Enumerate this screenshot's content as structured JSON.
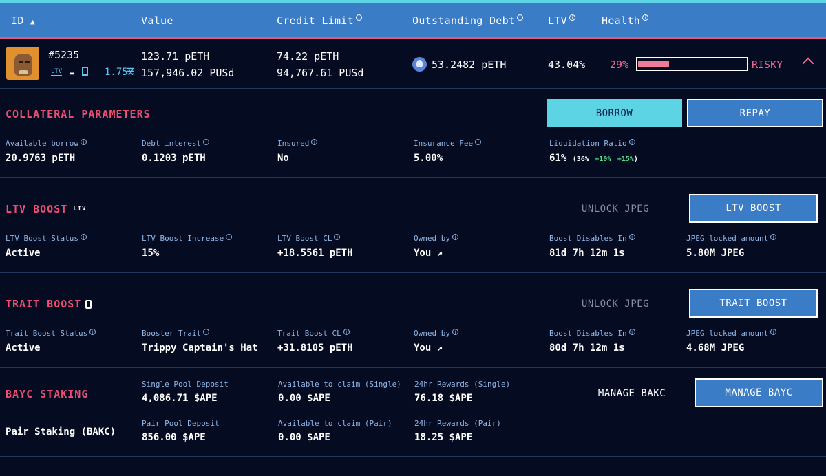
{
  "header": {
    "id": "ID",
    "value": "Value",
    "credit_limit": "Credit Limit",
    "outstanding_debt": "Outstanding Debt",
    "ltv": "LTV",
    "health": "Health"
  },
  "position": {
    "id": "#5235",
    "boost_icons": "LTV",
    "multiplier": "1.75x",
    "value_peth": "123.71 pETH",
    "value_pusd": "157,946.02 PUSd",
    "credit_peth": "74.22 pETH",
    "credit_pusd": "94,767.61 PUSd",
    "debt": "53.2482 pETH",
    "ltv": "43.04%",
    "health_pct": "29%",
    "health_fill": 0.29,
    "health_status": "RISKY"
  },
  "collateral": {
    "title": "COLLATERAL PARAMETERS",
    "borrow_label": "BORROW",
    "repay_label": "REPAY",
    "fields": [
      {
        "label": "Available borrow",
        "value": "20.9763 pETH"
      },
      {
        "label": "Debt interest",
        "value": "0.1203 pETH"
      },
      {
        "label": "Insured",
        "value": "No"
      },
      {
        "label": "Insurance Fee",
        "value": "5.00%"
      },
      {
        "label": "Liquidation Ratio",
        "value": "61%",
        "detail_a": "(36%",
        "detail_b": "+10%",
        "detail_c": "+15%",
        "detail_d": ")"
      }
    ]
  },
  "ltv_boost": {
    "title": "LTV BOOST",
    "unlock_label": "UNLOCK JPEG",
    "button_label": "LTV BOOST",
    "fields": [
      {
        "label": "LTV Boost Status",
        "value": "Active"
      },
      {
        "label": "LTV Boost Increase",
        "value": "15%"
      },
      {
        "label": "LTV Boost CL",
        "value": "+18.5561 pETH"
      },
      {
        "label": "Owned by",
        "value": "You"
      },
      {
        "label": "Boost Disables In",
        "value": "81d 7h 12m 1s"
      },
      {
        "label": "JPEG locked amount",
        "value": "5.80M JPEG"
      }
    ]
  },
  "trait_boost": {
    "title": "TRAIT BOOST",
    "unlock_label": "UNLOCK JPEG",
    "button_label": "TRAIT BOOST",
    "fields": [
      {
        "label": "Trait Boost Status",
        "value": "Active"
      },
      {
        "label": "Booster Trait",
        "value": "Trippy Captain's Hat"
      },
      {
        "label": "Trait Boost CL",
        "value": "+31.8105 pETH"
      },
      {
        "label": "Owned by",
        "value": "You"
      },
      {
        "label": "Boost Disables In",
        "value": "80d 7h 12m 1s"
      },
      {
        "label": "JPEG locked amount",
        "value": "4.68M JPEG"
      }
    ]
  },
  "staking": {
    "title": "BAYC STAKING",
    "pair_title": "Pair Staking (BAKC)",
    "manage_bakc": "MANAGE BAKC",
    "manage_bayc": "MANAGE BAYC",
    "single": [
      {
        "label": "Single Pool Deposit",
        "value": "4,086.71 $APE"
      },
      {
        "label": "Available to claim (Single)",
        "value": "0.00 $APE"
      },
      {
        "label": "24hr Rewards (Single)",
        "value": "76.18 $APE"
      }
    ],
    "pair": [
      {
        "label": "Pair Pool Deposit",
        "value": "856.00 $APE"
      },
      {
        "label": "Available to claim (Pair)",
        "value": "0.00 $APE"
      },
      {
        "label": "24hr Rewards (Pair)",
        "value": "18.25 $APE"
      }
    ]
  }
}
